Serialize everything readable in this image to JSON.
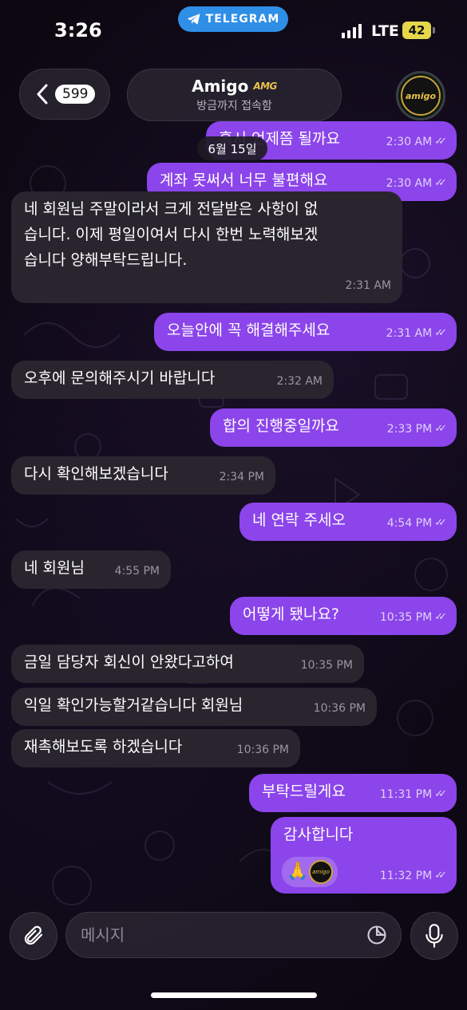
{
  "status_bar": {
    "time": "3:26",
    "return_app": "TELEGRAM",
    "network": "LTE",
    "battery": "42"
  },
  "header": {
    "back_count": "599",
    "title": "Amigo",
    "title_badge": "AMG",
    "subtitle": "방금까지 접속함",
    "avatar_text": "amigo"
  },
  "date_separator": "6월 15일",
  "messages": [
    {
      "dir": "out",
      "text": "혹시 언제쯤 될까요",
      "time": "2:30 AM",
      "read": true
    },
    {
      "dir": "out",
      "text": "계좌 못써서 너무 불편해요",
      "time": "2:30 AM",
      "read": true
    },
    {
      "dir": "in",
      "text": "네 회원님 주말이라서 크게 전달받은 사항이 없\n습니다. 이제 평일이여서 다시 한번 노력해보겠\n습니다 양해부탁드립니다.",
      "time": "2:31 AM"
    },
    {
      "dir": "out",
      "text": "오늘안에 꼭 해결해주세요",
      "time": "2:31 AM",
      "read": true
    },
    {
      "dir": "in",
      "text": "오후에 문의해주시기 바랍니다",
      "time": "2:32 AM"
    },
    {
      "dir": "out",
      "text": "합의 진행중일까요",
      "time": "2:33 PM",
      "read": true
    },
    {
      "dir": "in",
      "text": "다시 확인해보겠습니다",
      "time": "2:34 PM"
    },
    {
      "dir": "out",
      "text": "네 연락 주세오",
      "time": "4:54 PM",
      "read": true
    },
    {
      "dir": "in",
      "text": "네 회원님",
      "time": "4:55 PM"
    },
    {
      "dir": "out",
      "text": "어떻게 됐나요?",
      "time": "10:35 PM",
      "read": true
    },
    {
      "dir": "in",
      "text": "금일 담당자 회신이 안왔다고하여",
      "time": "10:35 PM"
    },
    {
      "dir": "in",
      "text": "익일 확인가능할거같습니다 회원님",
      "time": "10:36 PM"
    },
    {
      "dir": "in",
      "text": "재촉해보도록 하겠습니다",
      "time": "10:36 PM"
    },
    {
      "dir": "out",
      "text": "부탁드릴게요",
      "time": "11:31 PM",
      "read": true
    },
    {
      "dir": "out",
      "text": "감사합니다",
      "time": "11:32 PM",
      "read": true,
      "reaction": "🙏"
    }
  ],
  "composer": {
    "placeholder": "메시지"
  },
  "icons": {
    "back": "chevron-left-icon",
    "attach": "paperclip-icon",
    "sticker": "sticker-icon",
    "mic": "microphone-icon",
    "read": "double-check-icon"
  },
  "colors": {
    "outgoing_bubble": "#8b45ea",
    "incoming_bubble": "#29252e",
    "background": "#0b0710",
    "telegram_pill": "#2f8ee6"
  }
}
